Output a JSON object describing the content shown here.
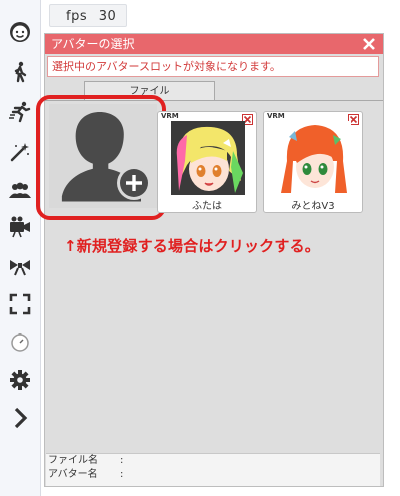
{
  "fps": {
    "label": "fps",
    "value": "30"
  },
  "sidebar": {
    "items": [
      {
        "icon": "face-icon"
      },
      {
        "icon": "walk-icon"
      },
      {
        "icon": "run-icon"
      },
      {
        "icon": "magic-wand-icon"
      },
      {
        "icon": "group-icon"
      },
      {
        "icon": "camera-icon"
      },
      {
        "icon": "ribbon-icon"
      },
      {
        "icon": "fullscreen-icon"
      },
      {
        "icon": "timer-icon"
      },
      {
        "icon": "gear-icon"
      },
      {
        "icon": "chevron-right-icon"
      }
    ]
  },
  "dialog": {
    "title": "アバターの選択",
    "message": "選択中のアバタースロットが対象になります。",
    "tab_label": "ファイル"
  },
  "avatars": [
    {
      "badge": "VRM",
      "name": "ふたは"
    },
    {
      "badge": "VRM",
      "name": "みとねV3"
    }
  ],
  "instruction": "↑新規登録する場合はクリックする。",
  "footer": {
    "file_name_label": "ファイル名",
    "file_name_sep": ":",
    "avatar_name_label": "アバター名",
    "avatar_name_sep": ":"
  },
  "colors": {
    "title_bar": "#e8676c",
    "highlight": "#e02020",
    "panel_bg": "#dedede"
  }
}
